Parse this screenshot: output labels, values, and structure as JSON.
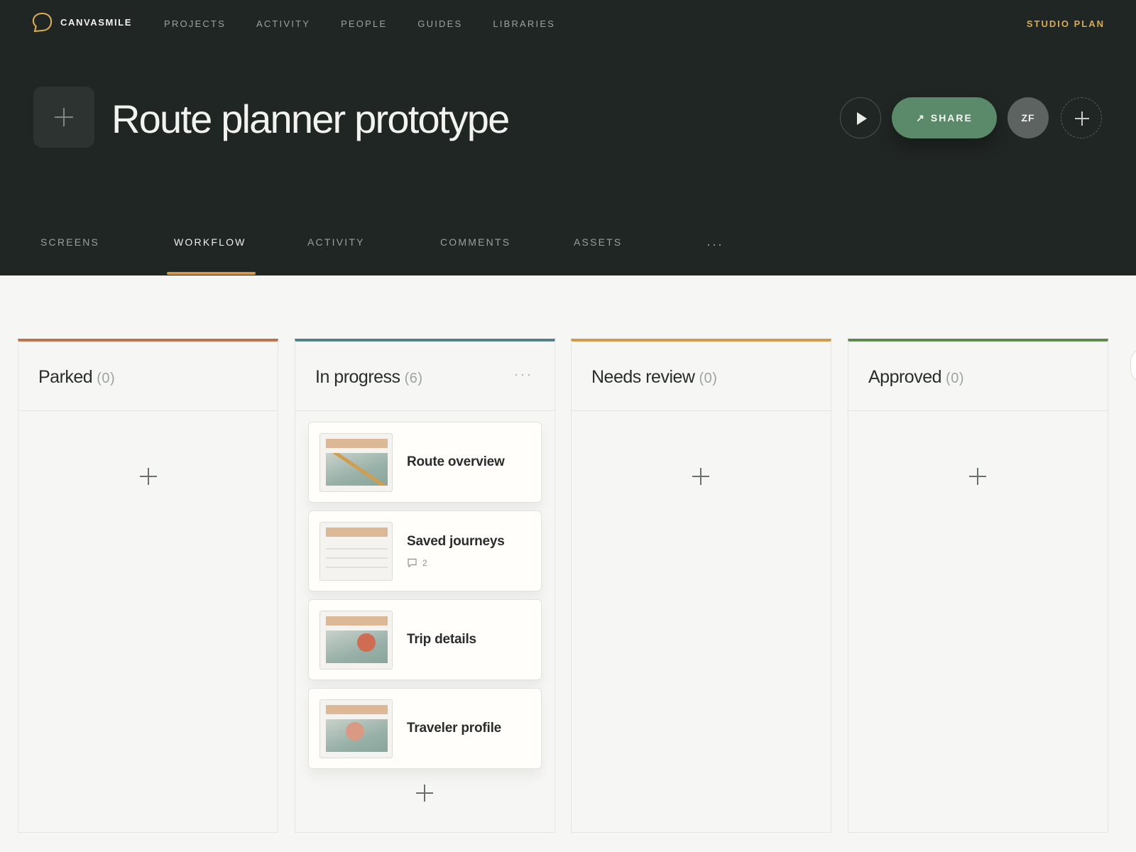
{
  "app": {
    "name": "CANVASMILE",
    "logo_icon": "speech-bubble-outline",
    "nav": [
      "PROJECTS",
      "ACTIVITY",
      "PEOPLE",
      "GUIDES",
      "LIBRARIES"
    ],
    "plan_label": "STUDIO PLAN",
    "accent_color": "#d8aa56"
  },
  "project": {
    "title": "Route planner prototype",
    "add_icon": "plus-icon",
    "play_icon": "play-icon",
    "share_label": "SHARE",
    "share_icon": "arrow-up-right-icon",
    "avatar_initials": "ZF",
    "add_member_icon": "plus-icon"
  },
  "tabs": {
    "items": [
      "SCREENS",
      "WORKFLOW",
      "ACTIVITY",
      "COMMENTS",
      "ASSETS"
    ],
    "active": "WORKFLOW",
    "more": "···"
  },
  "board": {
    "columns": [
      {
        "title": "Parked",
        "count": "(0)",
        "color": "#c0734f",
        "cards": []
      },
      {
        "title": "In progress",
        "count": "(6)",
        "color": "#56808a",
        "menu": "···",
        "cards": [
          {
            "title": "Route overview",
            "thumb": "map-with-route"
          },
          {
            "title": "Saved journeys",
            "thumb": "list",
            "comments": "2",
            "comment_icon": "comment-icon"
          },
          {
            "title": "Trip details",
            "thumb": "map-with-pin"
          },
          {
            "title": "Traveler profile",
            "thumb": "profile-photo"
          }
        ]
      },
      {
        "title": "Needs review",
        "count": "(0)",
        "color": "#d19a4c",
        "cards": []
      },
      {
        "title": "Approved",
        "count": "(0)",
        "color": "#5e8a4f",
        "cards": []
      }
    ]
  }
}
